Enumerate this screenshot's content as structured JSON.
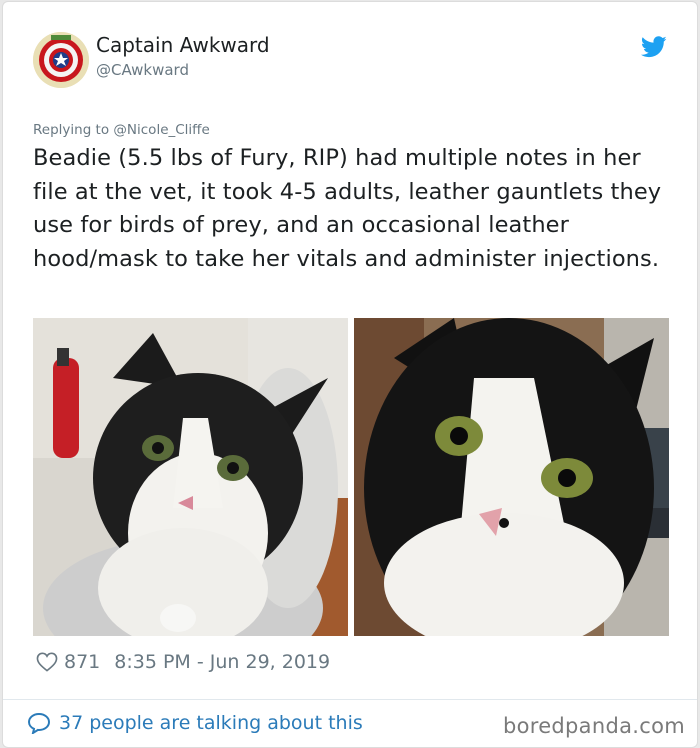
{
  "tweet": {
    "author_name": "Captain Awkward",
    "author_handle": "@CAwkward",
    "replying_label": "Replying to",
    "replying_handle": "@Nicole_Cliffe",
    "text": "Beadie (5.5 lbs of Fury, RIP) had multiple notes in her file at the vet, it took 4-5 adults, leather gauntlets they use for birds of prey, and an occasional leather hood/mask to take her vitals and administer injections.",
    "like_count": "871",
    "timestamp": "8:35 PM - Jun 29, 2019",
    "talking_text": "37 people are talking about this"
  },
  "icons": {
    "bird": "twitter-bird-icon",
    "heart": "heart-outline-icon",
    "bubble": "speech-bubble-icon"
  },
  "colors": {
    "twitter_blue": "#1da1f2",
    "link_blue": "#2b7bb9",
    "muted_gray": "#697882",
    "text_dark": "#1c2022"
  },
  "watermark": "boredpanda.com"
}
